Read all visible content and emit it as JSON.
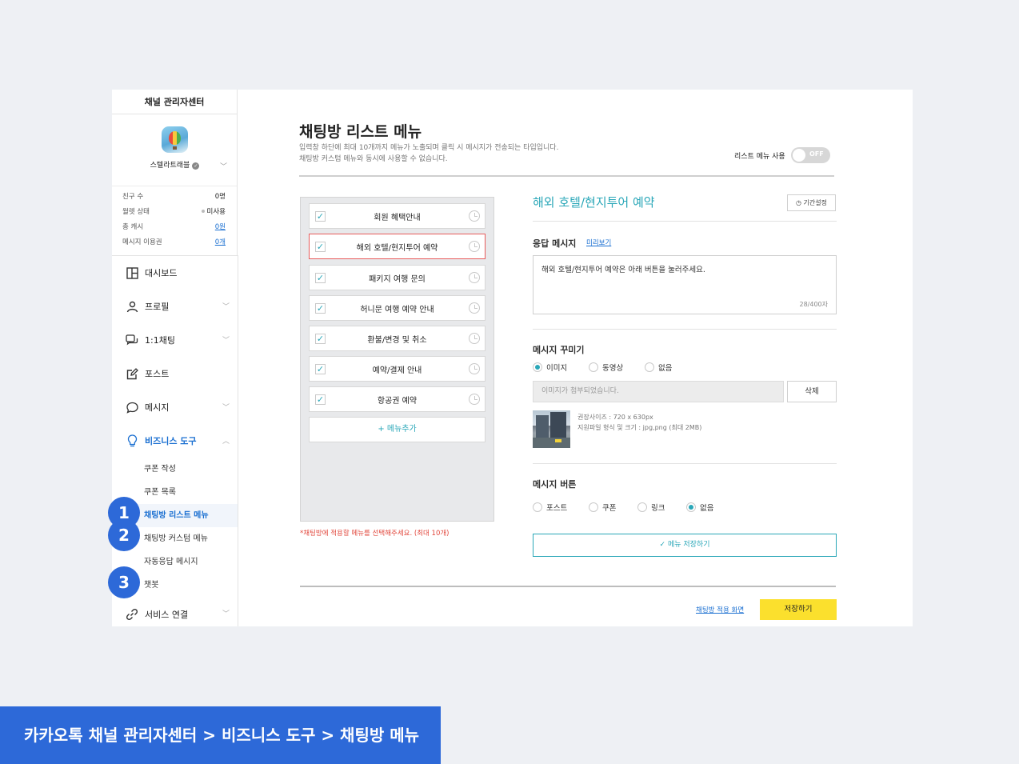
{
  "sidebar": {
    "title": "채널 관리자센터",
    "profile_name": "스텔라트래블",
    "stats": [
      {
        "label": "친구 수",
        "value": "0명"
      },
      {
        "label": "월렛 상태",
        "value": "미사용"
      },
      {
        "label": "총 캐시",
        "value": "0원"
      },
      {
        "label": "메시지 이용권",
        "value": "0개"
      }
    ],
    "menu": {
      "dashboard": "대시보드",
      "profile": "프로필",
      "chat": "1:1채팅",
      "post": "포스트",
      "message": "메시지",
      "business": "비즈니스 도구",
      "service": "서비스 연결"
    },
    "sub": {
      "coupon_create": "쿠폰 작성",
      "coupon_list": "쿠폰 목록",
      "chatroom_list_menu": "채팅방 리스트 메뉴",
      "chatroom_custom_menu": "채팅방 커스텀 메뉴",
      "auto_reply": "자동응답 메시지",
      "chatbot": "챗봇"
    }
  },
  "steps": [
    "1",
    "2",
    "3"
  ],
  "main": {
    "title": "채팅방 리스트 메뉴",
    "desc_line1": "입력창 하단에 최대 10개까지 메뉴가 노출되며 클릭 시 메시지가 전송되는 타입입니다.",
    "desc_line2": "채팅방 커스텀 메뉴와 동시에 사용할 수 없습니다.",
    "toggle_label": "리스트 메뉴 사용",
    "toggle_state": "OFF",
    "list_items": [
      "회원 혜택안내",
      "해외 호텔/현지투어 예약",
      "패키지 여행 문의",
      "허니문 여행 예약 안내",
      "환불/변경 및 취소",
      "예약/결제 안내",
      "항공권 예약"
    ],
    "add_menu": "+ 메뉴추가",
    "panel_note": "*채팅방에 적용할 메뉴를 선택해주세요. (최대 10개)",
    "detail": {
      "title": "해외 호텔/현지투어 예약",
      "period_button": "기간설정",
      "reply_label": "응답 메시지",
      "preview_link": "미리보기",
      "reply_text": "해외 호텔/현지투어 예약은 아래 버튼을 눌러주세요.",
      "char_count": "28/400자",
      "decorate_label": "메시지 꾸미기",
      "decorate_options": [
        "이미지",
        "동영상",
        "없음"
      ],
      "attach_text": "이미지가 첨부되었습니다.",
      "delete_button": "삭제",
      "img_info_line1": "권장사이즈 : 720 x 630px",
      "img_info_line2": "지원파일 형식 및 크기 : jpg,png (최대 2MB)",
      "button_label": "메시지 버튼",
      "button_options": [
        "포스트",
        "쿠폰",
        "링크",
        "없음"
      ],
      "save_menu_button": "메뉴 저장하기"
    },
    "apply_link": "채팅방 적용 화면",
    "save_button": "저장하기"
  },
  "breadcrumb": "카카오톡 채널 관리자센터 > 비즈니스 도구 > 채팅방 메뉴",
  "colors": {
    "accent": "#2aa7b8",
    "link": "#1a6fd1",
    "badge": "#2d69d8",
    "save": "#fbe02d",
    "error": "#e2483d"
  }
}
